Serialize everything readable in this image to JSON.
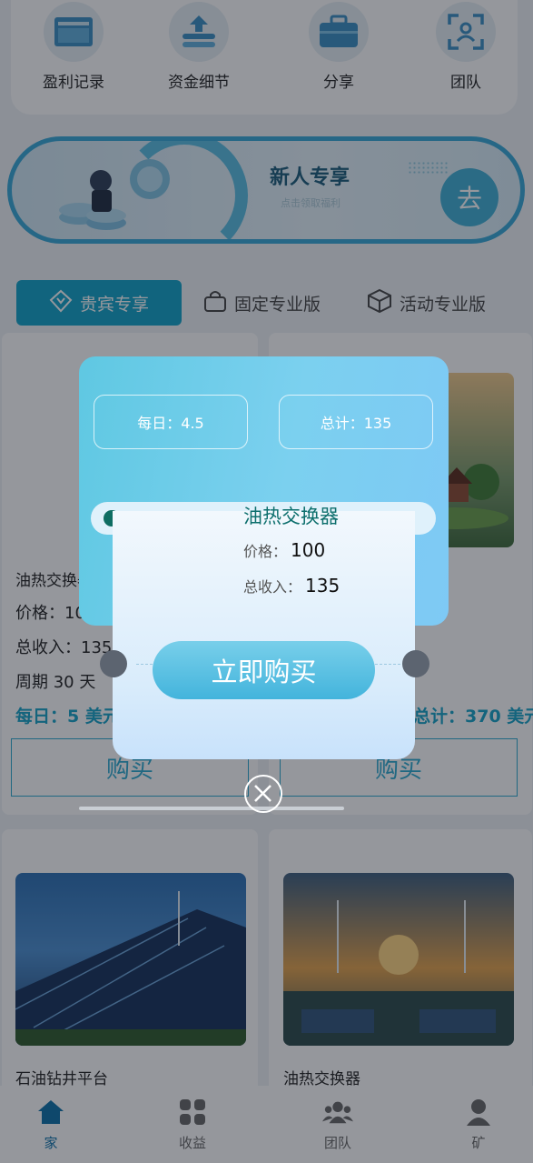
{
  "quick_actions": [
    {
      "label": "盈利记录",
      "icon": "record-icon"
    },
    {
      "label": "资金细节",
      "icon": "fund-upload-icon"
    },
    {
      "label": "分享",
      "icon": "briefcase-icon"
    },
    {
      "label": "团队",
      "icon": "team-scan-icon"
    }
  ],
  "banner": {
    "title": "新人专享",
    "subtitle": "点击领取福利",
    "go": "去"
  },
  "tabs": [
    {
      "label": "贵宾专享",
      "active": true
    },
    {
      "label": "固定专业版",
      "active": false
    },
    {
      "label": "活动专业版",
      "active": false
    }
  ],
  "products": {
    "left": {
      "name": "油热交换器",
      "price": "价格：100",
      "income": "总收入：135",
      "period": "周期 30 天",
      "daily": "每日：5 美元",
      "buy": "购买"
    },
    "right": {
      "total": "总计：370 美元",
      "buy": "购买"
    },
    "row2_left_name": "石油钻井平台",
    "row2_right_name": "油热交换器"
  },
  "modal": {
    "daily": "每日：4.5",
    "total": "总计：135",
    "product_name": "油热交换器",
    "price_label": "价格：",
    "price_value": "100",
    "income_label": "总收入：",
    "income_value": "135",
    "buy_label": "立即购买"
  },
  "nav": [
    {
      "label": "家",
      "active": true
    },
    {
      "label": "收益",
      "active": false
    },
    {
      "label": "团队",
      "active": false
    },
    {
      "label": "矿",
      "active": false
    }
  ],
  "colors": {
    "accent": "#0fa3c8",
    "modal_blue": "#7bd0ef",
    "product_name": "#0d6f6d"
  }
}
